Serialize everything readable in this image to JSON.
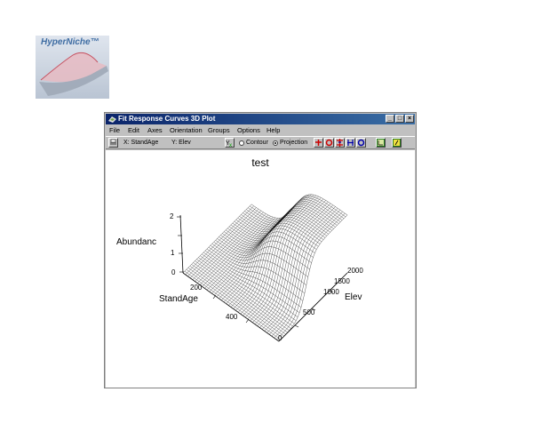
{
  "logo": {
    "text": "HyperNiche™"
  },
  "window": {
    "title": "Fit Response Curves 3D Plot",
    "controls": {
      "minimize": "_",
      "maximize": "□",
      "close": "×"
    }
  },
  "menu": {
    "items": [
      {
        "label": "File"
      },
      {
        "label": "Edit"
      },
      {
        "label": "Axes"
      },
      {
        "label": "Orientation"
      },
      {
        "label": "Groups"
      },
      {
        "label": "Options"
      },
      {
        "label": "Help"
      }
    ]
  },
  "toolbar": {
    "x_text": "X: StandAge",
    "y_text": "Y: Elev",
    "contour_label": "Contour",
    "projection_label": "Projection",
    "selected_mode": "Projection"
  },
  "plot": {
    "title": "test",
    "z_label": "Abundanc",
    "x_label": "StandAge",
    "y_label": "Elev",
    "z_ticks": [
      "0",
      "1",
      "2"
    ],
    "x_ticks": [
      "200",
      "400"
    ],
    "y_ticks": [
      "0",
      "500",
      "1000",
      "1500",
      "2000"
    ]
  }
}
